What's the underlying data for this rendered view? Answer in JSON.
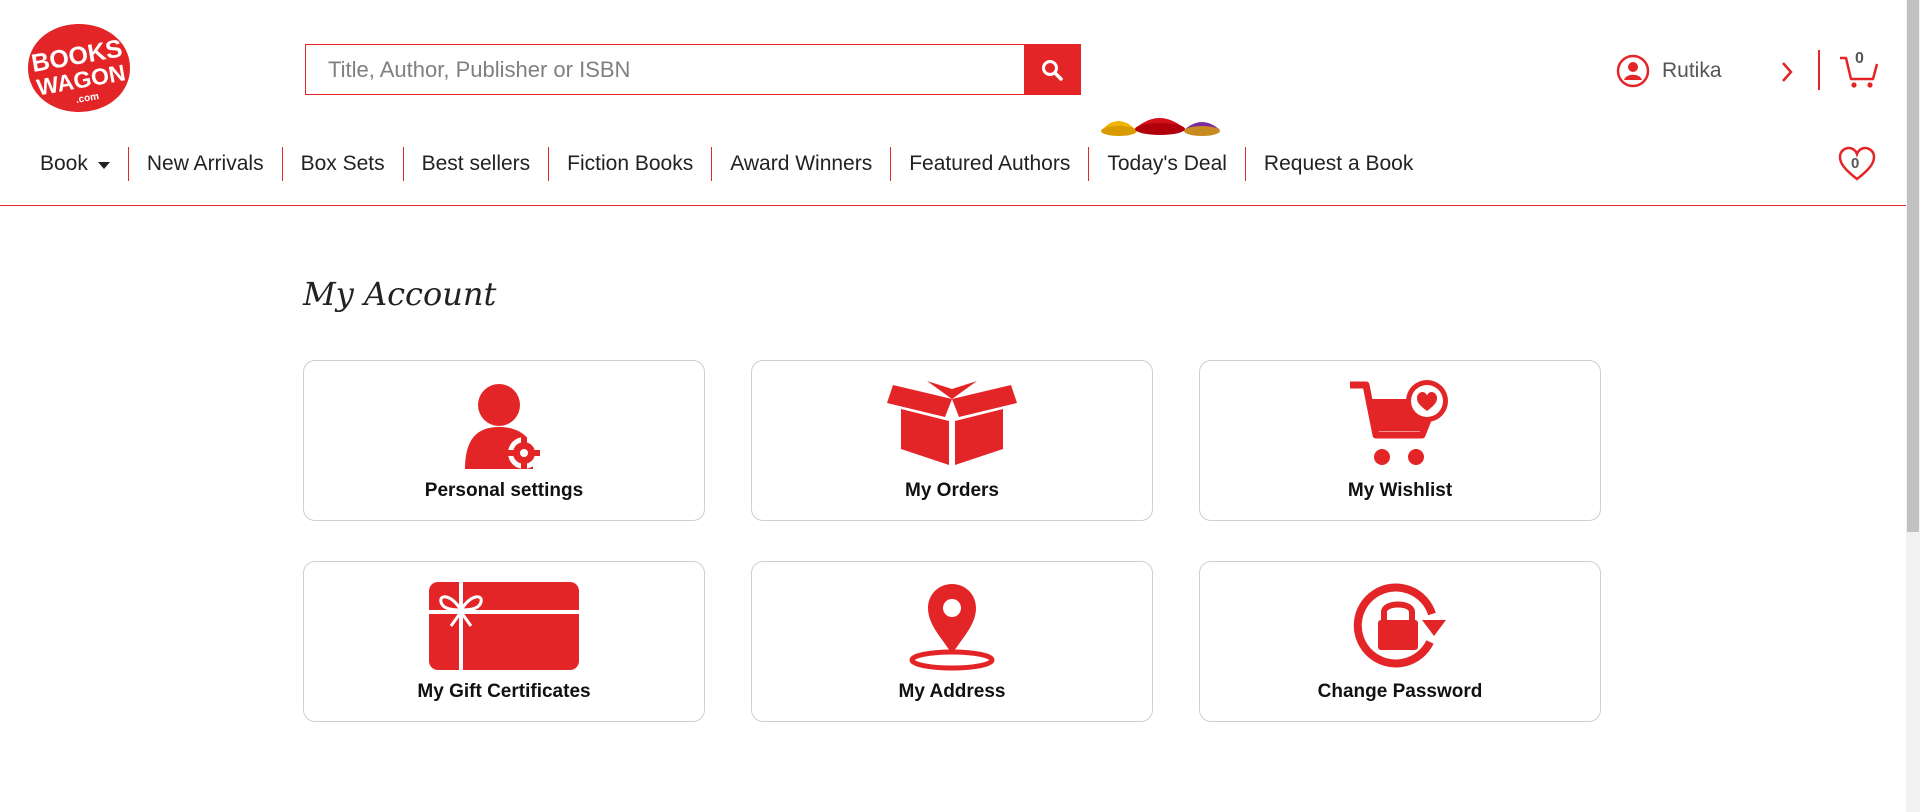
{
  "brand": {
    "logo_line1": "BOOKS",
    "logo_line2": "WAGON",
    "logo_suffix": ".com",
    "accent": "#e42527"
  },
  "search": {
    "placeholder": "Title, Author, Publisher or ISBN",
    "value": "",
    "icon": "search-icon"
  },
  "user": {
    "name": "Rutika",
    "icon": "user-circle-icon"
  },
  "cart": {
    "count": "0",
    "icon": "cart-icon"
  },
  "wishlist": {
    "count": "0",
    "icon": "heart-icon"
  },
  "nav": {
    "items": [
      {
        "label": "Book"
      },
      {
        "label": "New Arrivals"
      },
      {
        "label": "Box Sets"
      },
      {
        "label": "Best sellers"
      },
      {
        "label": "Fiction Books"
      },
      {
        "label": "Award Winners"
      },
      {
        "label": "Featured Authors"
      },
      {
        "label": "Today's Deal"
      },
      {
        "label": "Request a Book"
      }
    ]
  },
  "main": {
    "title": "My Account",
    "cards": [
      {
        "label": "Personal settings",
        "icon": "user-settings-icon"
      },
      {
        "label": "My Orders",
        "icon": "box-icon"
      },
      {
        "label": "My Wishlist",
        "icon": "cart-heart-icon"
      },
      {
        "label": "My Gift Certificates",
        "icon": "gift-card-icon"
      },
      {
        "label": "My Address",
        "icon": "location-pin-icon"
      },
      {
        "label": "Change Password",
        "icon": "lock-refresh-icon"
      }
    ]
  }
}
